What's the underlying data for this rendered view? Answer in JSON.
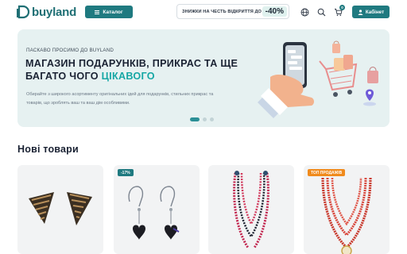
{
  "header": {
    "logo_text": "buyland",
    "catalog_label": "Каталог",
    "promo_text": "ЗНИЖКИ НА ЧЕСТЬ ВІДКРИТТЯ ДО",
    "promo_value": "-40%",
    "cart_count": "0",
    "cabinet_label": "Кабінет",
    "icons": [
      "globe-icon",
      "search-icon",
      "cart-icon",
      "user-icon",
      "menu-icon"
    ]
  },
  "hero": {
    "welcome": "ПАСКАВО ПРОСИМО ДО BUYLAND",
    "title_main": "МАГАЗИН ПОДАРУНКІВ, ПРИКРАС ТА ЩЕ БАГАТО ЧОГО ",
    "title_accent": "ЦІКАВОГО",
    "description": "Обирайте з широкого асортименту оригінальних ідей для подарунків, стильних прикрас та товарів, що зроблять ваш та ваш дім особливими.",
    "slides": 3,
    "active_slide": 1,
    "accent_color": "#16a7a5"
  },
  "new_products": {
    "title": "Нові товари",
    "cards": [
      {
        "badge": ""
      },
      {
        "badge": "-17%"
      },
      {
        "badge": ""
      },
      {
        "badge": "ТОП ПРОДАЖІВ"
      }
    ]
  },
  "colors": {
    "brand": "#1f7a80",
    "hero_bg": "#e6f1f1",
    "top_badge": "#f08a1c"
  }
}
